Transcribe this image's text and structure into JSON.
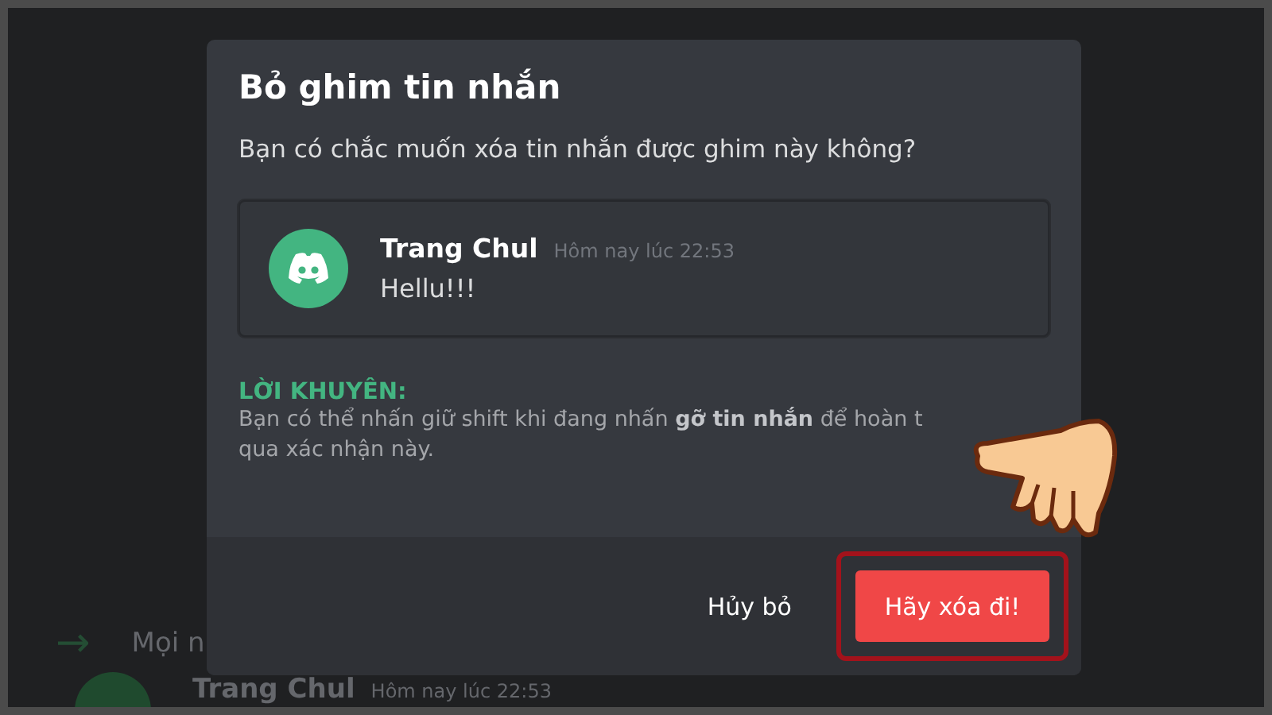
{
  "background": {
    "arrow": "→",
    "join_text": "Mọi n",
    "author": "Trang Chul",
    "time": "Hôm nay lúc 22:53"
  },
  "dialog": {
    "title": "Bỏ ghim tin nhắn",
    "question": "Bạn có chắc muốn xóa tin nhắn được ghim này không?",
    "message": {
      "author": "Trang Chul",
      "time": "Hôm nay lúc 22:53",
      "text": "Hellu!!!"
    },
    "tip": {
      "label": "LỜI KHUYÊN:",
      "lines": [
        "Bạn có thể nhấn giữ shift khi đang nhấn **gỡ tin nhắn** để hoàn t",
        "qua xác nhận này."
      ]
    },
    "buttons": [
      {
        "label": "Hủy bỏ",
        "kind": "link",
        "highlighted": false
      },
      {
        "label": "Hãy xóa đi!",
        "kind": "danger",
        "highlighted": true
      }
    ]
  }
}
